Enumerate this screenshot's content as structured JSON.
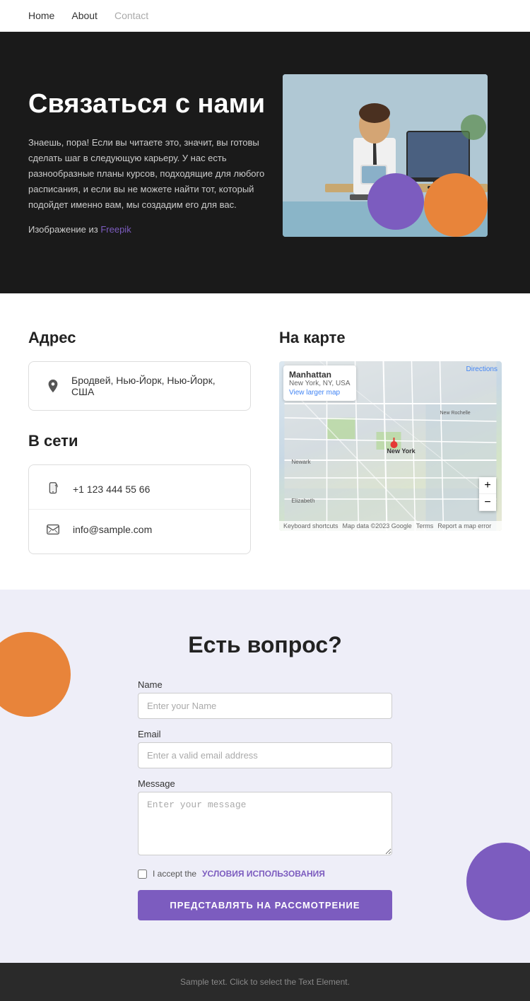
{
  "nav": {
    "items": [
      {
        "label": "Home",
        "active": false
      },
      {
        "label": "About",
        "active": false
      },
      {
        "label": "Contact",
        "active": true
      }
    ]
  },
  "hero": {
    "title": "Связаться с нами",
    "description": "Знаешь, пора! Если вы читаете это, значит, вы готовы сделать шаг в следующую карьеру. У нас есть разнообразные планы курсов, подходящие для любого расписания, и если вы не можете найти тот, который подойдет именно вам, мы создадим его для вас.",
    "image_credit_prefix": "Изображение из ",
    "image_credit_link": "Freepik"
  },
  "address_section": {
    "title": "Адрес",
    "address": "Бродвей, Нью-Йорк, Нью-Йорк, США"
  },
  "network_section": {
    "title": "В сети",
    "phone": "+1 123 444 55 66",
    "email": "info@sample.com"
  },
  "map_section": {
    "title": "На карте",
    "city": "Manhattan",
    "state": "New York, NY, USA",
    "view_larger": "View larger map",
    "directions": "Directions",
    "keyboard_shortcuts": "Keyboard shortcuts",
    "map_data": "Map data ©2023 Google",
    "terms": "Terms",
    "report": "Report a map error"
  },
  "form_section": {
    "title": "Есть вопрос?",
    "name_label": "Name",
    "name_placeholder": "Enter your Name",
    "email_label": "Email",
    "email_placeholder": "Enter a valid email address",
    "message_label": "Message",
    "message_placeholder": "Enter your message",
    "checkbox_prefix": "I accept the ",
    "checkbox_link": "УСЛОВИЯ ИСПОЛЬЗОВАНИЯ",
    "submit_label": "ПРЕДСТАВЛЯТЬ НА РАССМОТРЕНИЕ"
  },
  "footer": {
    "text": "Sample text. Click to select the Text Element."
  }
}
